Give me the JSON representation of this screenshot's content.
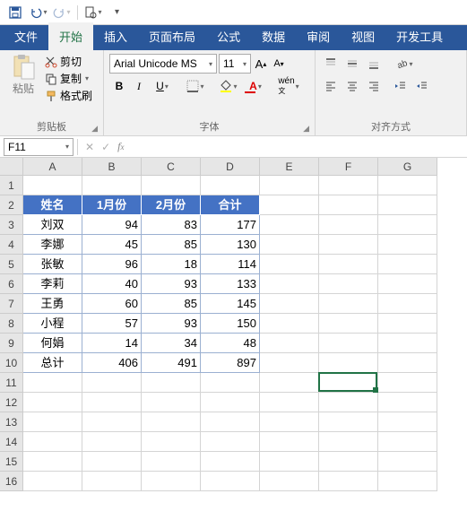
{
  "qat": {
    "save": "save-icon",
    "undo": "undo-icon",
    "redo": "redo-icon",
    "print": "print-icon"
  },
  "tabs": [
    "文件",
    "开始",
    "插入",
    "页面布局",
    "公式",
    "数据",
    "审阅",
    "视图",
    "开发工具"
  ],
  "active_tab": 1,
  "ribbon": {
    "clipboard": {
      "label": "剪贴板",
      "paste": "粘贴",
      "cut": "剪切",
      "copy": "复制",
      "painter": "格式刷"
    },
    "font": {
      "label": "字体",
      "name": "Arial Unicode MS",
      "size": "11",
      "grow": "A",
      "shrink": "A"
    },
    "align": {
      "label": "对齐方式"
    }
  },
  "namebox": "F11",
  "formula": "",
  "columns": [
    "A",
    "B",
    "C",
    "D",
    "E",
    "F",
    "G"
  ],
  "rows": [
    1,
    2,
    3,
    4,
    5,
    6,
    7,
    8,
    9,
    10,
    11,
    12,
    13,
    14,
    15,
    16
  ],
  "table": {
    "headers": [
      "姓名",
      "1月份",
      "2月份",
      "合计"
    ],
    "data": [
      [
        "刘双",
        "94",
        "83",
        "177"
      ],
      [
        "李娜",
        "45",
        "85",
        "130"
      ],
      [
        "张敏",
        "96",
        "18",
        "114"
      ],
      [
        "李莉",
        "40",
        "93",
        "133"
      ],
      [
        "王勇",
        "60",
        "85",
        "145"
      ],
      [
        "小程",
        "57",
        "93",
        "150"
      ],
      [
        "何娟",
        "14",
        "34",
        "48"
      ],
      [
        "总计",
        "406",
        "491",
        "897"
      ]
    ]
  },
  "selection": {
    "row": 11,
    "col": "F"
  }
}
